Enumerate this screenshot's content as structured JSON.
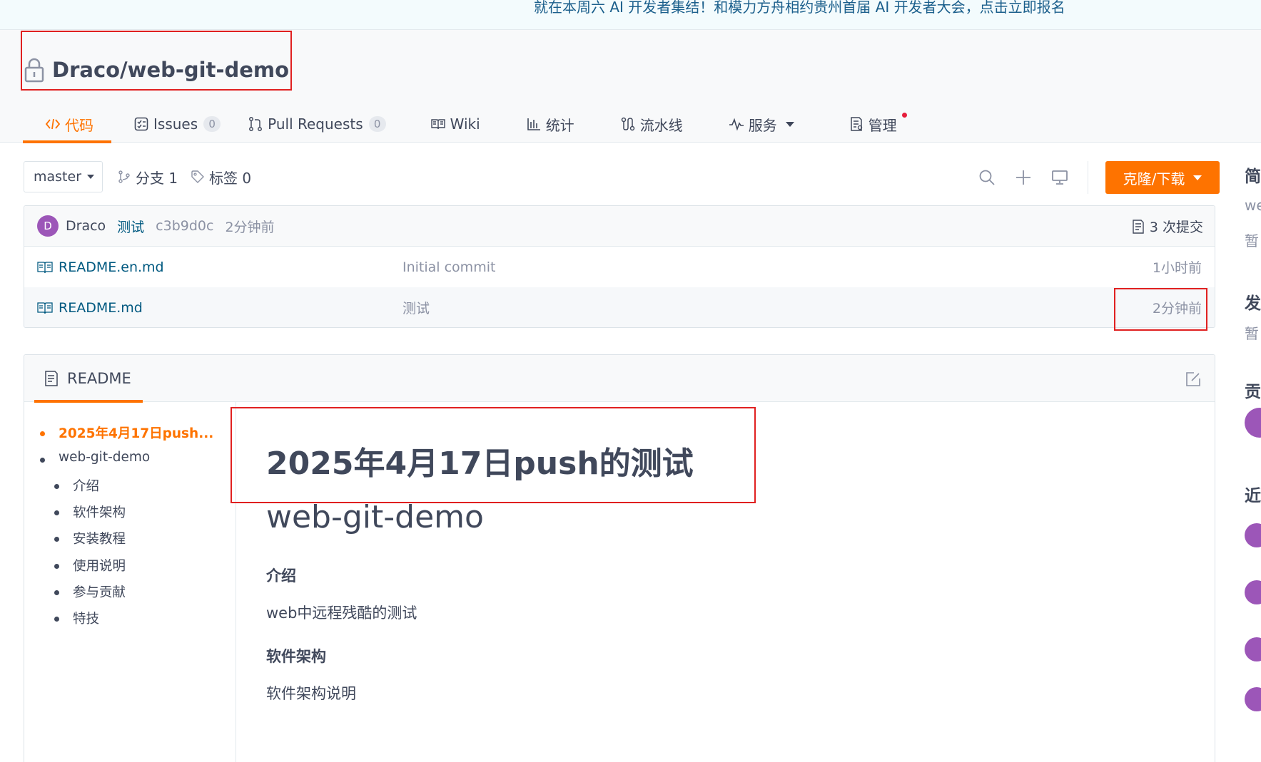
{
  "banner": {
    "text": "就在本周六 AI 开发者集结！和模力方舟相约贵州首届 AI 开发者大会，点击立即报名"
  },
  "repo": {
    "name": "Draco/web-git-demo"
  },
  "tabs": [
    {
      "label": "代码",
      "icon": "code-icon"
    },
    {
      "label": "Issues",
      "count": "0",
      "icon": "issues-icon"
    },
    {
      "label": "Pull Requests",
      "count": "0",
      "icon": "pull-request-icon"
    },
    {
      "label": "Wiki",
      "icon": "book-icon"
    },
    {
      "label": "统计",
      "icon": "bar-chart-icon"
    },
    {
      "label": "流水线",
      "icon": "pipeline-icon"
    },
    {
      "label": "服务",
      "icon": "pulse-icon"
    },
    {
      "label": "管理",
      "icon": "settings-doc-icon"
    }
  ],
  "toolbar": {
    "branch": "master",
    "branches": "分支 1",
    "tags": "标签 0",
    "clone_label": "克隆/下载"
  },
  "commit": {
    "avatar_letter": "D",
    "author": "Draco",
    "message": "测试",
    "sha": "c3b9d0c",
    "time": "2分钟前",
    "count_label": "3 次提交"
  },
  "files": [
    {
      "name": "README.en.md",
      "message": "Initial commit",
      "time": "1小时前"
    },
    {
      "name": "README.md",
      "message": "测试",
      "time": "2分钟前"
    }
  ],
  "readme": {
    "tab_label": "README",
    "toc": [
      "2025年4月17日push...",
      "web-git-demo",
      "介绍",
      "软件架构",
      "安装教程",
      "使用说明",
      "参与贡献",
      "特技"
    ],
    "h1": "2025年4月17日push的测试",
    "h1b": "web-git-demo",
    "intro_h": "介绍",
    "intro_p": "web中远程残酷的测试",
    "arch_h": "软件架构",
    "arch_p": "软件架构说明"
  },
  "sidebar": {
    "h1": "简",
    "t1": "we",
    "t2": "暂",
    "h2": "发",
    "t3": "暂",
    "h3": "贡",
    "h4": "近"
  },
  "colors": {
    "accent": "#fe7300",
    "link": "#005980",
    "avatar": "#9c56b8",
    "highlight": "#e02020"
  }
}
